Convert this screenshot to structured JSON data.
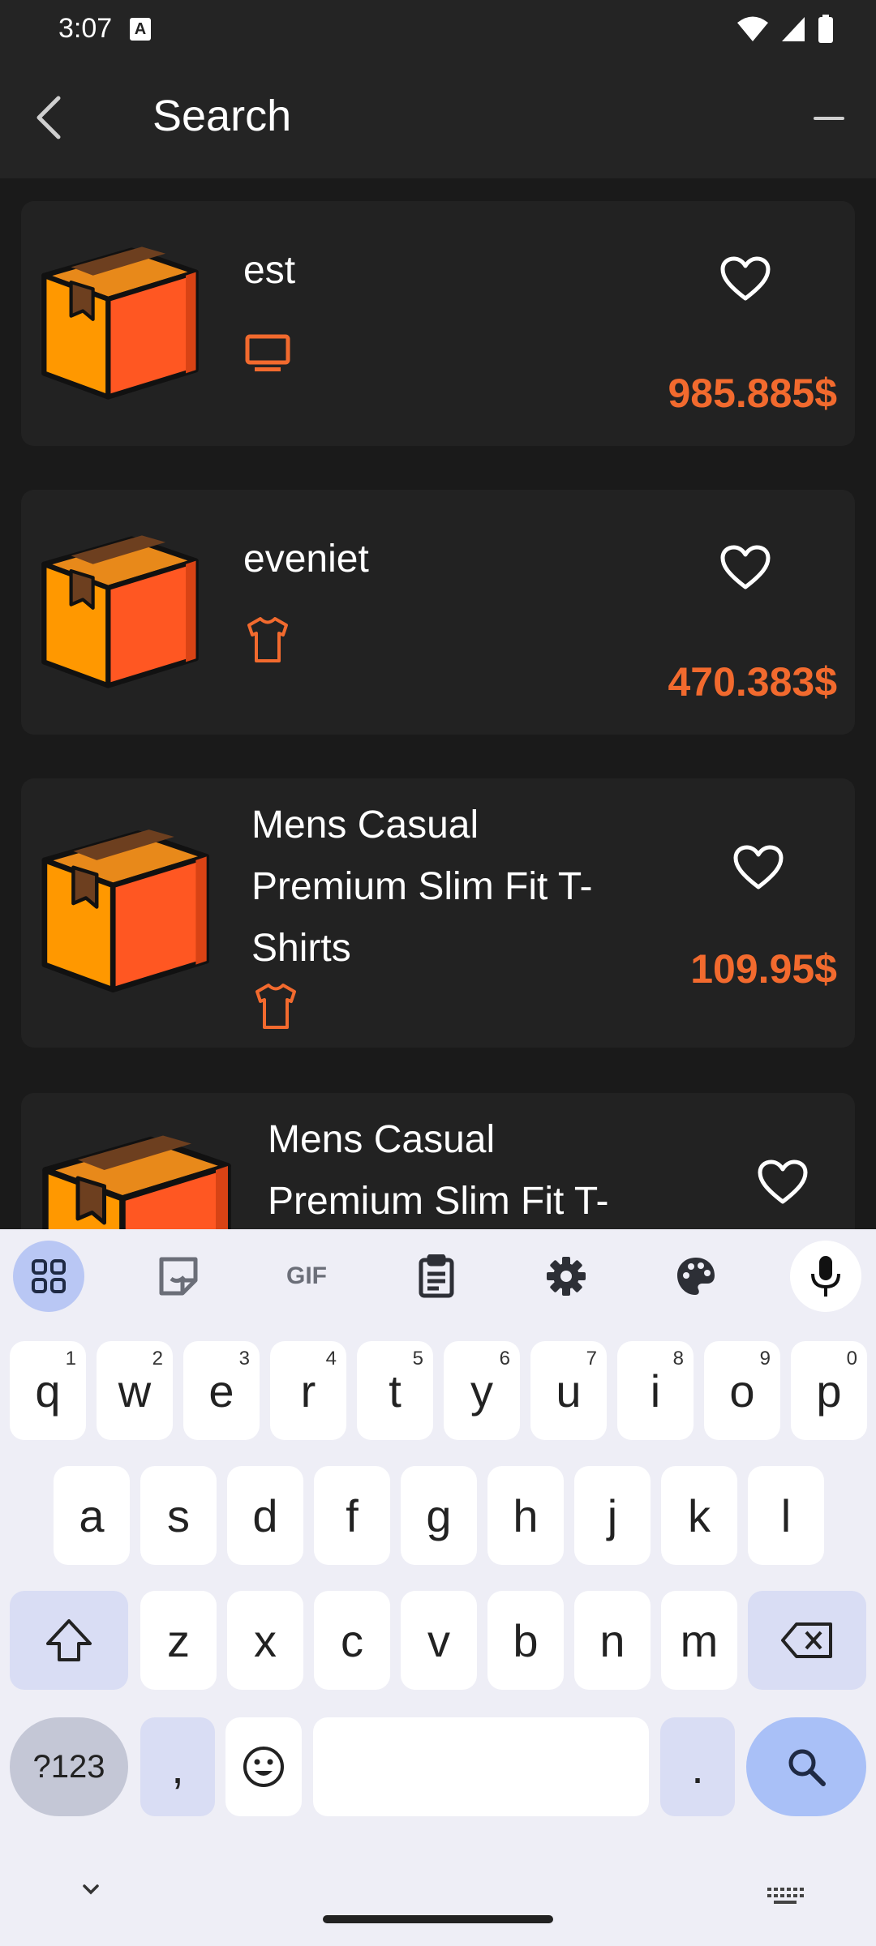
{
  "status": {
    "time": "3:07",
    "notif_glyph": "A"
  },
  "appbar": {
    "title": "Search"
  },
  "products": [
    {
      "name": "est",
      "category_icon": "monitor-icon",
      "price": "985.885$"
    },
    {
      "name": "eveniet",
      "category_icon": "tshirt-icon",
      "price": "470.383$"
    },
    {
      "name": "Mens Casual Premium Slim Fit T-Shirts",
      "name_lines": [
        "Mens Casual",
        "Premium Slim Fit T-",
        "Shirts"
      ],
      "category_icon": "tshirt-icon",
      "price": "109.95$"
    },
    {
      "name_lines": [
        "Mens Casual",
        "Premium Slim Fit T-"
      ]
    }
  ],
  "keyboard": {
    "toolbar": [
      "apps-icon",
      "sticker-icon",
      "GIF",
      "clipboard-icon",
      "settings-icon",
      "palette-icon",
      "mic-icon"
    ],
    "row1": [
      {
        "k": "q",
        "h": "1"
      },
      {
        "k": "w",
        "h": "2"
      },
      {
        "k": "e",
        "h": "3"
      },
      {
        "k": "r",
        "h": "4"
      },
      {
        "k": "t",
        "h": "5"
      },
      {
        "k": "y",
        "h": "6"
      },
      {
        "k": "u",
        "h": "7"
      },
      {
        "k": "i",
        "h": "8"
      },
      {
        "k": "o",
        "h": "9"
      },
      {
        "k": "p",
        "h": "0"
      }
    ],
    "row2": [
      "a",
      "s",
      "d",
      "f",
      "g",
      "h",
      "j",
      "k",
      "l"
    ],
    "row3": [
      "z",
      "x",
      "c",
      "v",
      "b",
      "n",
      "m"
    ],
    "symbols_label": "?123",
    "comma": ",",
    "period": "."
  },
  "colors": {
    "accent": "#f26a2e",
    "box_front": "#ff5722",
    "box_side": "#ff9800"
  }
}
